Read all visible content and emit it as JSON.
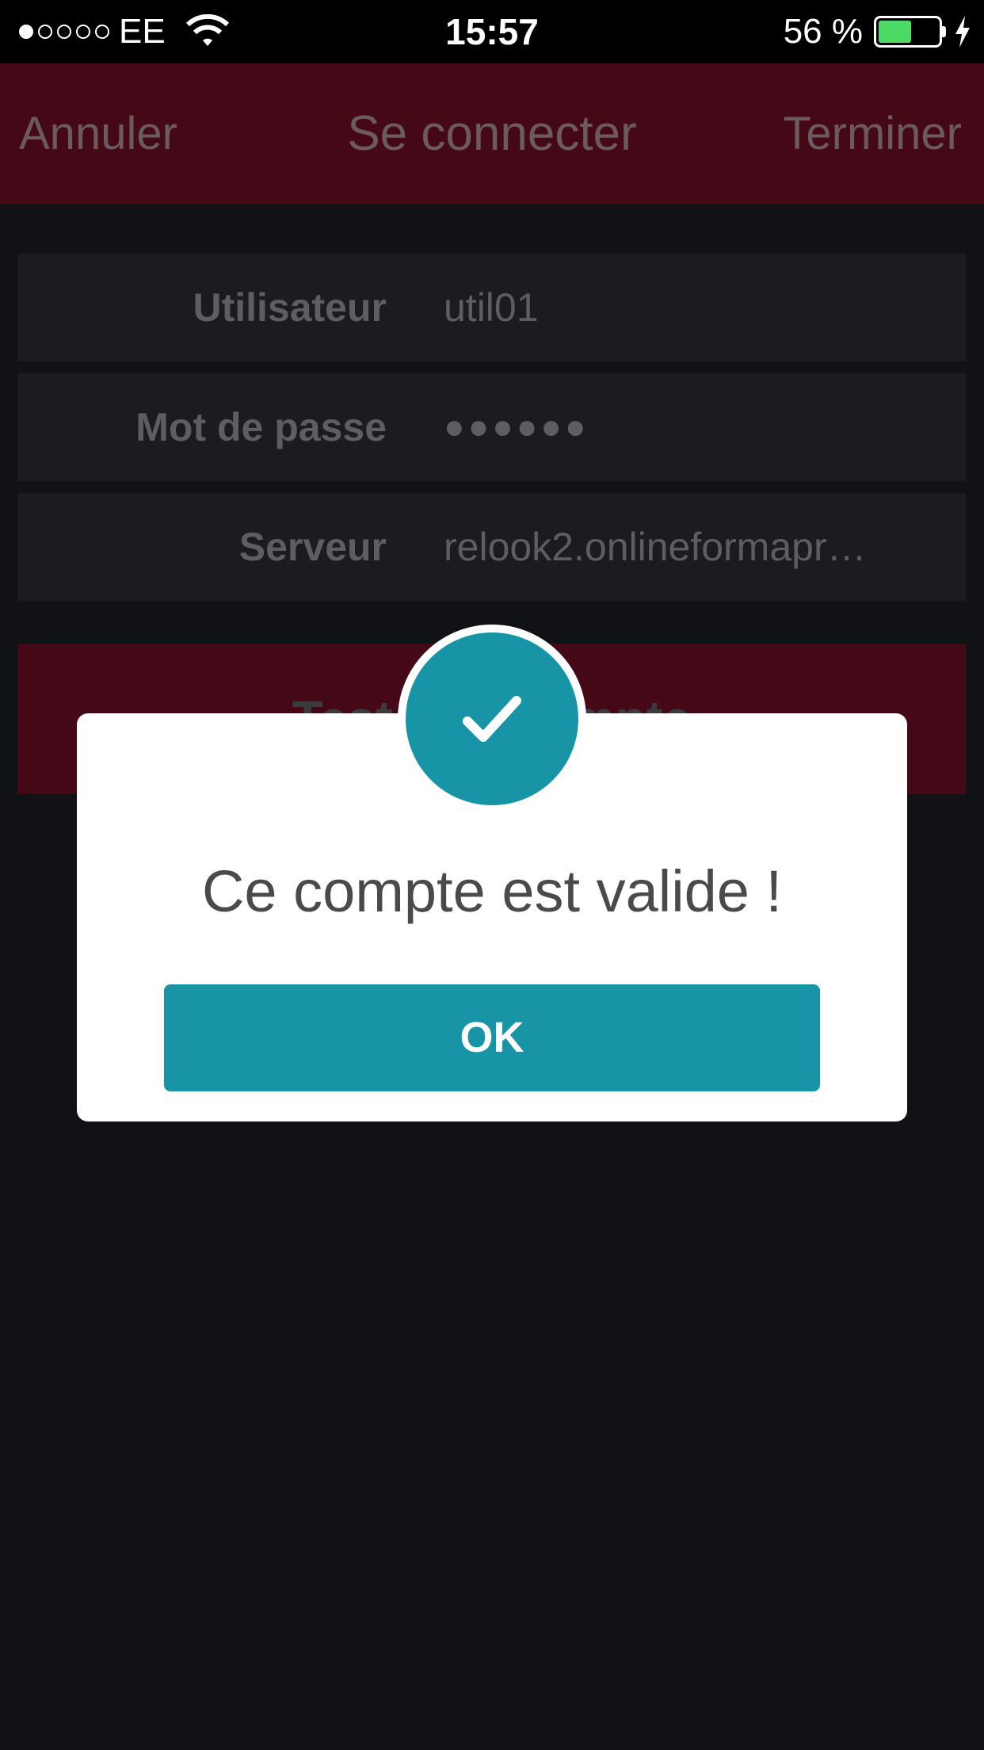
{
  "status_bar": {
    "carrier": "EE",
    "time": "15:57",
    "battery_percent_text": "56 %",
    "battery_level": 0.56,
    "signal_bars_filled": 1,
    "signal_bars_total": 5
  },
  "navbar": {
    "cancel_label": "Annuler",
    "title": "Se connecter",
    "done_label": "Terminer"
  },
  "form": {
    "user_label": "Utilisateur",
    "user_value": "util01",
    "password_label": "Mot de passe",
    "password_value": "●●●●●●",
    "server_label": "Serveur",
    "server_value": "relook2.onlineformapr…"
  },
  "test_button_label": "Tester le compte",
  "dialog": {
    "message": "Ce compte est valide !",
    "ok_label": "OK",
    "icon": "checkmark-icon"
  },
  "colors": {
    "navbar": "#440816",
    "accent": "#1795a6",
    "battery": "#4cd964"
  }
}
